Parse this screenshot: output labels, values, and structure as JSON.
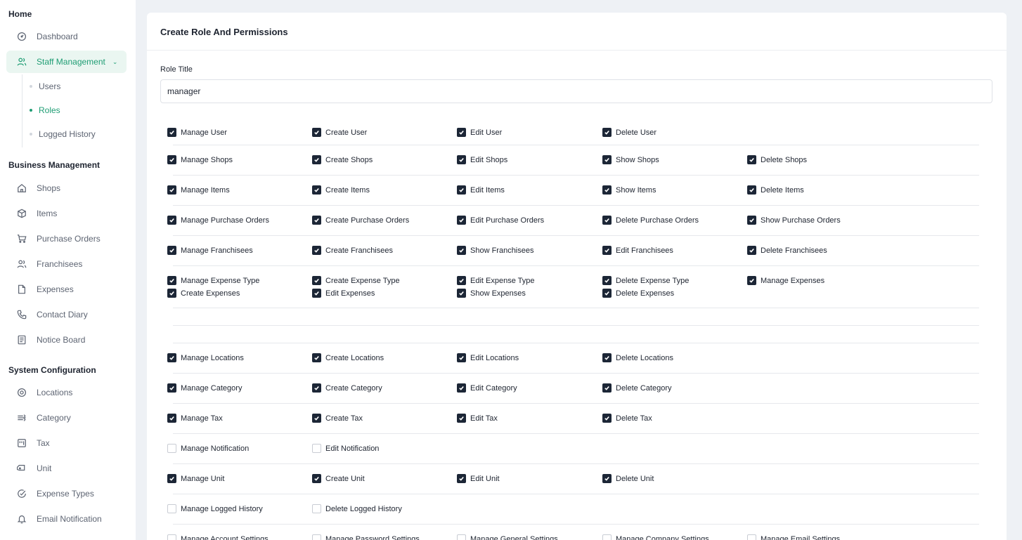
{
  "sidebar": {
    "sections": {
      "home": "Home",
      "business": "Business Management",
      "system": "System Configuration"
    },
    "items": {
      "dashboard": {
        "label": "Dashboard",
        "icon": "dashboard-icon"
      },
      "staff": {
        "label": "Staff Management",
        "icon": "users-icon",
        "active": true
      },
      "shops": {
        "label": "Shops",
        "icon": "home-icon"
      },
      "items": {
        "label": "Items",
        "icon": "box-icon"
      },
      "purchase_orders": {
        "label": "Purchase Orders",
        "icon": "cart-icon"
      },
      "franchisees": {
        "label": "Franchisees",
        "icon": "users-icon"
      },
      "expenses": {
        "label": "Expenses",
        "icon": "file-icon"
      },
      "contact_diary": {
        "label": "Contact Diary",
        "icon": "phone-icon"
      },
      "notice_board": {
        "label": "Notice Board",
        "icon": "note-icon"
      },
      "locations": {
        "label": "Locations",
        "icon": "location-icon"
      },
      "category": {
        "label": "Category",
        "icon": "category-icon"
      },
      "tax": {
        "label": "Tax",
        "icon": "tax-icon"
      },
      "unit": {
        "label": "Unit",
        "icon": "tag-icon"
      },
      "expense_types": {
        "label": "Expense Types",
        "icon": "check-circle-icon"
      },
      "email_notification": {
        "label": "Email Notification",
        "icon": "bell-icon"
      }
    },
    "staff_sub": {
      "users": "Users",
      "roles": "Roles",
      "logged_history": "Logged History"
    }
  },
  "form": {
    "title": "Create Role And Permissions",
    "role_title_label": "Role Title",
    "role_title_value": "manager"
  },
  "permissions": {
    "user": [
      {
        "label": "Manage User",
        "checked": true
      },
      {
        "label": "Create User",
        "checked": true
      },
      {
        "label": "Edit User",
        "checked": true
      },
      {
        "label": "Delete User",
        "checked": true
      }
    ],
    "shops": [
      {
        "label": "Manage Shops",
        "checked": true
      },
      {
        "label": "Create Shops",
        "checked": true
      },
      {
        "label": "Edit Shops",
        "checked": true
      },
      {
        "label": "Show Shops",
        "checked": true
      },
      {
        "label": "Delete Shops",
        "checked": true
      }
    ],
    "items": [
      {
        "label": "Manage Items",
        "checked": true
      },
      {
        "label": "Create Items",
        "checked": true
      },
      {
        "label": "Edit Items",
        "checked": true
      },
      {
        "label": "Show Items",
        "checked": true
      },
      {
        "label": "Delete Items",
        "checked": true
      }
    ],
    "purchase_orders": [
      {
        "label": "Manage Purchase Orders",
        "checked": true
      },
      {
        "label": "Create Purchase Orders",
        "checked": true
      },
      {
        "label": "Edit Purchase Orders",
        "checked": true
      },
      {
        "label": "Delete Purchase Orders",
        "checked": true
      },
      {
        "label": "Show Purchase Orders",
        "checked": true
      }
    ],
    "franchisees": [
      {
        "label": "Manage Franchisees",
        "checked": true
      },
      {
        "label": "Create Franchisees",
        "checked": true
      },
      {
        "label": "Show Franchisees",
        "checked": true
      },
      {
        "label": "Edit Franchisees",
        "checked": true
      },
      {
        "label": "Delete Franchisees",
        "checked": true
      }
    ],
    "expenses_a": [
      {
        "label": "Manage Expense Type",
        "checked": true
      },
      {
        "label": "Create Expense Type",
        "checked": true
      },
      {
        "label": "Edit Expense Type",
        "checked": true
      },
      {
        "label": "Delete Expense Type",
        "checked": true
      },
      {
        "label": "Manage Expenses",
        "checked": true
      }
    ],
    "expenses_b": [
      {
        "label": "Create Expenses",
        "checked": true
      },
      {
        "label": "Edit Expenses",
        "checked": true
      },
      {
        "label": "Show Expenses",
        "checked": true
      },
      {
        "label": "Delete Expenses",
        "checked": true
      }
    ],
    "locations": [
      {
        "label": "Manage Locations",
        "checked": true
      },
      {
        "label": "Create Locations",
        "checked": true
      },
      {
        "label": "Edit Locations",
        "checked": true
      },
      {
        "label": "Delete Locations",
        "checked": true
      }
    ],
    "category": [
      {
        "label": "Manage Category",
        "checked": true
      },
      {
        "label": "Create Category",
        "checked": true
      },
      {
        "label": "Edit Category",
        "checked": true
      },
      {
        "label": "Delete Category",
        "checked": true
      }
    ],
    "tax": [
      {
        "label": "Manage Tax",
        "checked": true
      },
      {
        "label": "Create Tax",
        "checked": true
      },
      {
        "label": "Edit Tax",
        "checked": true
      },
      {
        "label": "Delete Tax",
        "checked": true
      }
    ],
    "notification": [
      {
        "label": "Manage Notification",
        "checked": false
      },
      {
        "label": "Edit Notification",
        "checked": false
      }
    ],
    "unit": [
      {
        "label": "Manage Unit",
        "checked": true
      },
      {
        "label": "Create Unit",
        "checked": true
      },
      {
        "label": "Edit Unit",
        "checked": true
      },
      {
        "label": "Delete Unit",
        "checked": true
      }
    ],
    "logged_history": [
      {
        "label": "Manage Logged History",
        "checked": false
      },
      {
        "label": "Delete Logged History",
        "checked": false
      }
    ],
    "settings": [
      {
        "label": "Manage Account Settings",
        "checked": false
      },
      {
        "label": "Manage Password Settings",
        "checked": false
      },
      {
        "label": "Manage General Settings",
        "checked": false
      },
      {
        "label": "Manage Company Settings",
        "checked": false
      },
      {
        "label": "Manage Email Settings",
        "checked": false
      }
    ]
  },
  "colors": {
    "accent": "#1f9d74",
    "checkbox": "#1c2636",
    "background": "#eef1f5"
  }
}
